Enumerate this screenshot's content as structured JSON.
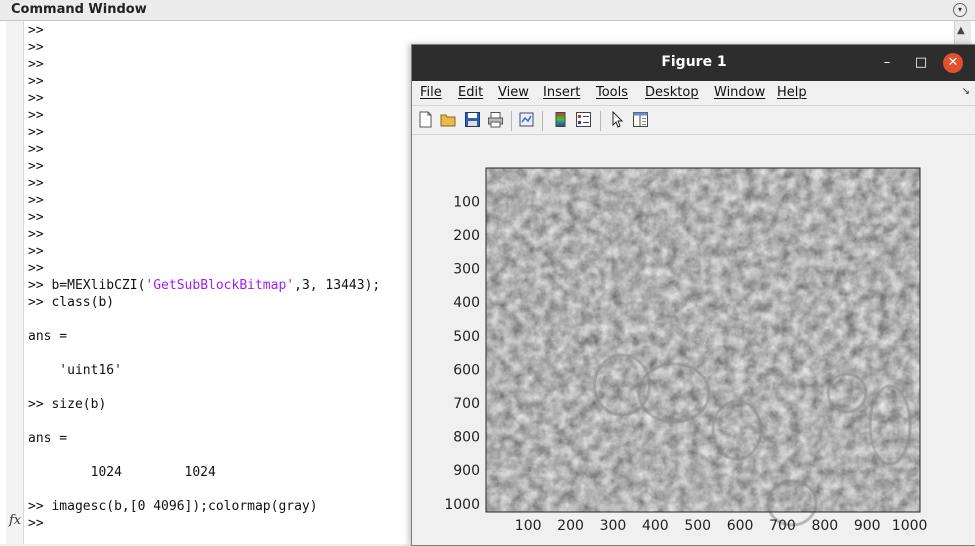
{
  "command_window": {
    "title": "Command Window",
    "prompt_only_lines": ">>",
    "prompt_count": 15,
    "line_b_prefix": ">> b=MEXlibCZI(",
    "line_b_string": "'GetSubBlockBitmap'",
    "line_b_suffix": ",3, 13443);",
    "line_class": ">> class(b)",
    "ans_label_1": "ans =",
    "ans_value_1": "    'uint16'",
    "line_size": ">> size(b)",
    "ans_label_2": "ans =",
    "ans_value_2": "        1024        1024",
    "line_imagesc": ">> imagesc(b,[0 4096]);colormap(gray)",
    "current_prompt": ">>",
    "fx_label": "fx"
  },
  "figure": {
    "title": "Figure 1",
    "window_controls": {
      "minimize": "–",
      "maximize": "□",
      "close": "✕"
    },
    "menu": [
      "File",
      "Edit",
      "View",
      "Insert",
      "Tools",
      "Desktop",
      "Window",
      "Help"
    ],
    "toolbar": [
      "new-figure-icon",
      "open-file-icon",
      "save-icon",
      "print-icon",
      "link-plot-icon",
      "colorbar-icon",
      "legend-icon",
      "select-arrow-icon",
      "property-editor-icon"
    ]
  },
  "chart_data": {
    "type": "heatmap",
    "title": "",
    "xlabel": "",
    "ylabel": "",
    "colormap": "gray",
    "clim": [
      0,
      4096
    ],
    "image_size": [
      1024,
      1024
    ],
    "xlim": [
      0.5,
      1024.5
    ],
    "ylim": [
      0.5,
      1024.5
    ],
    "y_reversed": true,
    "x_ticks": [
      100,
      200,
      300,
      400,
      500,
      600,
      700,
      800,
      900,
      1000
    ],
    "y_ticks": [
      100,
      200,
      300,
      400,
      500,
      600,
      700,
      800,
      900,
      1000
    ],
    "grid": false
  },
  "colors": {
    "titlebar": "#2d2d2d",
    "close_button": "#e2502c",
    "string_literal": "#a020f0"
  }
}
